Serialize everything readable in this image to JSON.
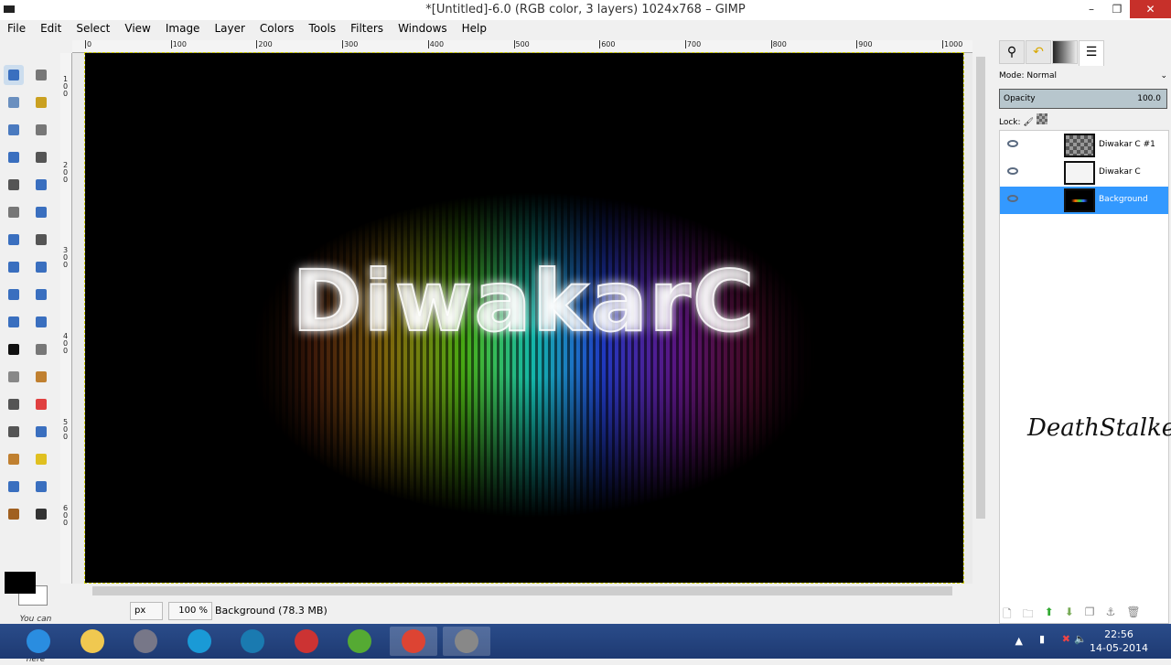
{
  "window": {
    "title": "*[Untitled]-6.0 (RGB color, 3 layers) 1024x768 – GIMP",
    "minimize": "–",
    "maximize": "❐",
    "close": "✕"
  },
  "menu": [
    "File",
    "Edit",
    "Select",
    "View",
    "Image",
    "Layer",
    "Colors",
    "Tools",
    "Filters",
    "Windows",
    "Help"
  ],
  "toolbox": {
    "tools": [
      "rect-select",
      "ellipse-select",
      "free-select",
      "fuzzy-select",
      "select-by-color",
      "scissors",
      "foreground-select",
      "paths",
      "color-picker",
      "zoom",
      "measure",
      "move",
      "align",
      "crop",
      "rotate",
      "scale",
      "shear",
      "perspective",
      "flip",
      "cage",
      "text",
      "bucket-fill",
      "blend",
      "pencil",
      "paintbrush",
      "eraser",
      "airbrush",
      "ink",
      "clone",
      "heal",
      "perspective-clone",
      "blur",
      "smudge",
      "dodge-burn"
    ],
    "drop_message": "You can drop dockable dialogs here",
    "fg_color": "#000000",
    "bg_color": "#ffffff"
  },
  "rulers": {
    "horizontal": [
      "0",
      "100",
      "200",
      "300",
      "400",
      "500",
      "600",
      "700",
      "800",
      "900",
      "1000"
    ],
    "vertical": [
      "100",
      "200",
      "300",
      "400",
      "500",
      "600"
    ]
  },
  "canvas": {
    "text": "DiwakarC"
  },
  "statusbar": {
    "unit": "px",
    "zoom": "100 %",
    "info": "Background (78.3 MB)"
  },
  "layers_panel": {
    "mode": "Mode: Normal",
    "opacity_label": "Opacity",
    "opacity_value": "100.0",
    "lock_label": "Lock:",
    "layers": [
      {
        "name": "Diwakar C #1",
        "selected": false
      },
      {
        "name": "Diwakar C",
        "selected": false
      },
      {
        "name": "Background",
        "selected": true
      }
    ],
    "signature": "DeathStalker"
  },
  "taskbar": {
    "apps": [
      "internet-explorer",
      "file-explorer",
      "control-panel",
      "media-center",
      "movie-maker",
      "audio-app",
      "music-app",
      "chrome",
      "gimp"
    ],
    "time": "22:56",
    "date": "14-05-2014"
  },
  "colors": {
    "selection": "#3399ff",
    "taskbar": "#1e3a72",
    "close": "#c7302a"
  }
}
